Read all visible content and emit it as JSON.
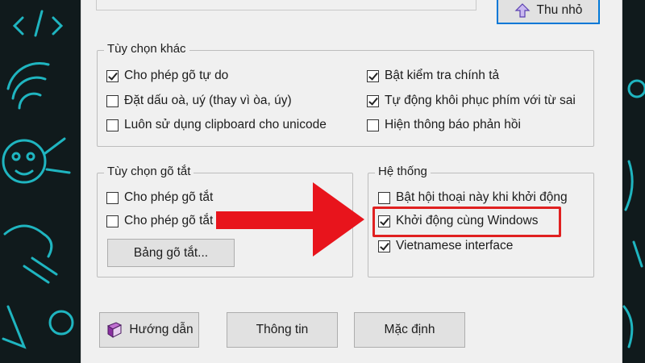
{
  "top": {
    "shrink_button": "Thu nhỏ"
  },
  "other_options": {
    "title": "Tùy chọn khác",
    "items": [
      {
        "label": "Cho phép gõ tự do",
        "checked": true
      },
      {
        "label": "Đặt dấu oà, uý (thay vì òa, úy)",
        "checked": false
      },
      {
        "label": "Luôn sử dụng clipboard cho unicode",
        "checked": false
      },
      {
        "label": "Bật kiểm tra chính tả",
        "checked": true
      },
      {
        "label": "Tự động khôi phục phím với từ sai",
        "checked": true
      },
      {
        "label": "Hiện thông báo phản hồi",
        "checked": false
      }
    ]
  },
  "shortcut_options": {
    "title": "Tùy chọn gõ tắt",
    "items": [
      {
        "label": "Cho phép gõ tắt",
        "checked": false
      },
      {
        "label": "Cho phép gõ tắt",
        "checked": false
      }
    ],
    "table_button": "Bảng gõ tắt..."
  },
  "system": {
    "title": "Hệ thống",
    "items": [
      {
        "label": "Bật hội thoại này khi khởi động",
        "checked": false
      },
      {
        "label": "Khởi động cùng Windows",
        "checked": true
      },
      {
        "label": "Vietnamese interface",
        "checked": true
      }
    ]
  },
  "buttons": {
    "guide": "Hướng dẫn",
    "info": "Thông tin",
    "default": "Mặc định"
  },
  "colors": {
    "annotation": "#e02020",
    "background": "#101a1c",
    "doodle": "#1fb5c0",
    "dialog": "#f0f0f0"
  },
  "icons": [
    "up-arrow-icon",
    "book-icon",
    "red-arrow",
    "doodle-background"
  ]
}
